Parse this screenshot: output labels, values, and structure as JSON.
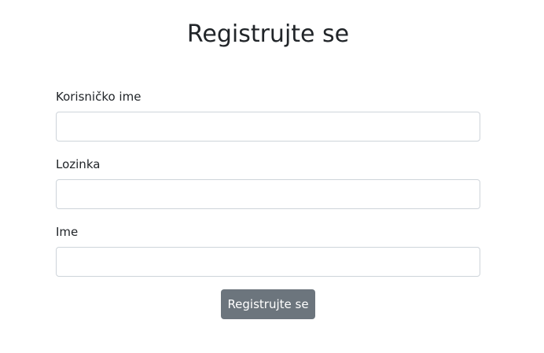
{
  "title": "Registrujte se",
  "fields": [
    {
      "label": "Korisničko ime",
      "value": ""
    },
    {
      "label": "Lozinka",
      "value": ""
    },
    {
      "label": "Ime",
      "value": ""
    }
  ],
  "submit_label": "Registrujte se",
  "colors": {
    "button": "#6c757d",
    "text": "#212529",
    "border": "#ced4da"
  }
}
